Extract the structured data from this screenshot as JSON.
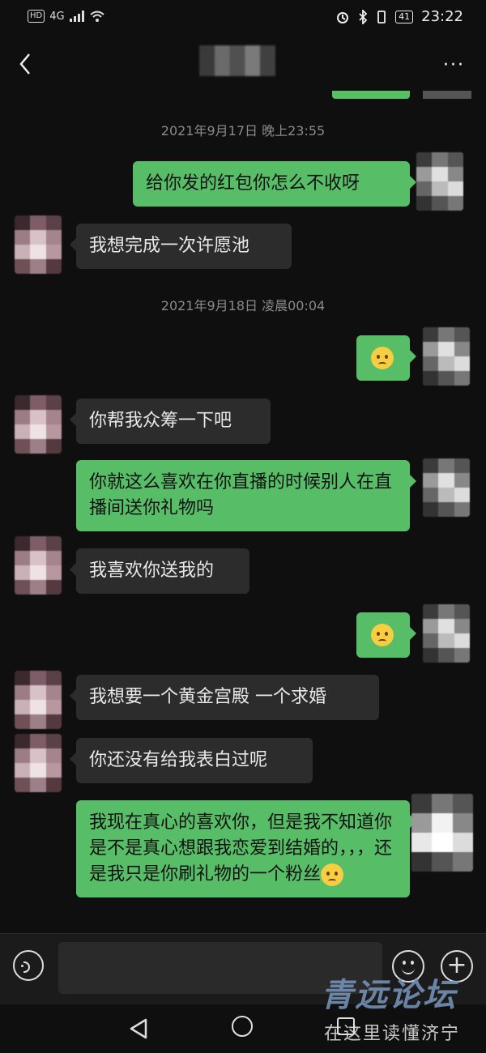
{
  "status_bar": {
    "hd": "HD",
    "network": "4G",
    "battery": "41",
    "time": "23:22"
  },
  "nav": {
    "more_label": "···"
  },
  "messages": [
    {
      "type": "timestamp",
      "text": "2021年9月17日 晚上23:55"
    },
    {
      "type": "out",
      "text": "给你发的红包你怎么不收呀"
    },
    {
      "type": "in",
      "text": "我想完成一次许愿池"
    },
    {
      "type": "timestamp",
      "text": "2021年9月18日 凌晨00:04"
    },
    {
      "type": "out",
      "emoji": "wozy-face-emoji"
    },
    {
      "type": "in",
      "text": "你帮我众筹一下吧"
    },
    {
      "type": "out",
      "text": "你就这么喜欢在你直播的时候别人在直播间送你礼物吗"
    },
    {
      "type": "in",
      "text": "我喜欢你送我的"
    },
    {
      "type": "out",
      "emoji": "wozy-face-emoji"
    },
    {
      "type": "in",
      "text": "我想要一个黄金宫殿 一个求婚"
    },
    {
      "type": "in",
      "text": "你还没有给我表白过呢"
    },
    {
      "type": "out",
      "text": "我现在真心的喜欢你，但是我不知道你是不是真心想跟我恋爱到结婚的，，，还是我只是你刷礼物的一个粉丝"
    }
  ],
  "input_bar": {
    "value": "",
    "plus_label": "+"
  },
  "watermark": {
    "line1": "青远论坛",
    "line2": "在这里读懂济宁"
  },
  "colors": {
    "background": "#0f0f0f",
    "outgoing_bubble": "#57be67",
    "incoming_bubble": "#2c2c2c",
    "timestamp": "#8a8a8a"
  }
}
